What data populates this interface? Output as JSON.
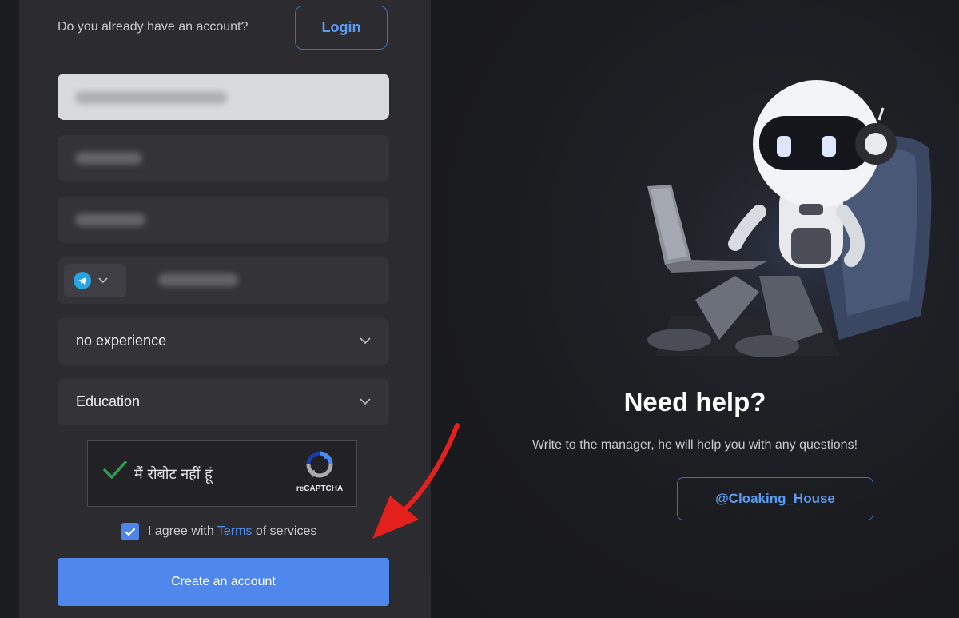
{
  "login_prompt": {
    "question": "Do you already have an account?",
    "login_label": "Login"
  },
  "form": {
    "experience_select": {
      "value": "no experience"
    },
    "category_select": {
      "value": "Education"
    },
    "captcha": {
      "label": "मैं रोबोट नहीं हूं",
      "brand": "reCAPTCHA"
    },
    "agree": {
      "before": "I agree with",
      "link": "Terms",
      "after": "of services",
      "checked": true
    },
    "submit_label": "Create an account"
  },
  "help": {
    "title": "Need help?",
    "text": "Write to the manager, he will help you with any questions!",
    "contact_label": "@Cloaking_House"
  },
  "colors": {
    "accent": "#4f87ec",
    "panel": "#2b2b30",
    "background": "#1a1b1f",
    "annotation_arrow": "#e3201b"
  },
  "icons": [
    "telegram-icon",
    "chevron-down-icon",
    "checkmark-icon",
    "recaptcha-icon",
    "check-icon",
    "robot-illustration",
    "red-arrow-annotation"
  ]
}
